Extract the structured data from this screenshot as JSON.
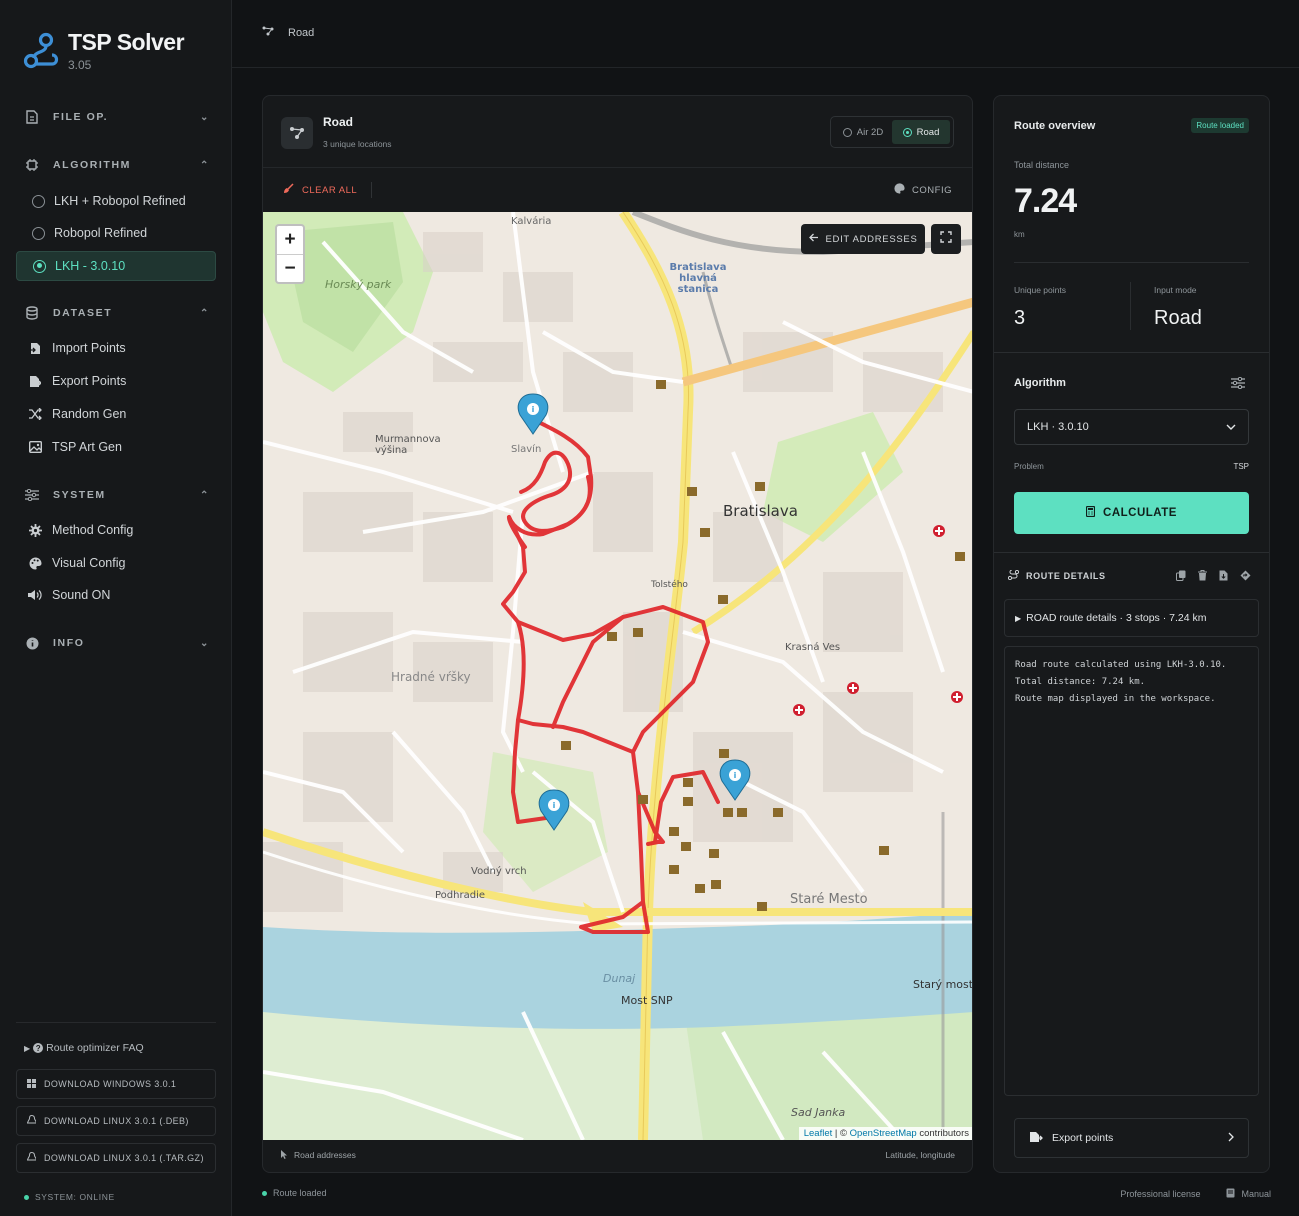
{
  "app": {
    "title": "TSP Solver",
    "version": "3.05"
  },
  "sidebar": {
    "file_op": "FILE OP.",
    "algorithm": "ALGORITHM",
    "algorithms": [
      {
        "label": "LKH + Robopol Refined"
      },
      {
        "label": "Robopol Refined"
      },
      {
        "label": "LKH - 3.0.10"
      }
    ],
    "dataset": "DATASET",
    "dataset_items": [
      {
        "label": "Import Points"
      },
      {
        "label": "Export Points"
      },
      {
        "label": "Random Gen"
      },
      {
        "label": "TSP Art Gen"
      }
    ],
    "system": "SYSTEM",
    "system_items": [
      {
        "label": "Method Config"
      },
      {
        "label": "Visual Config"
      },
      {
        "label": "Sound ON"
      }
    ],
    "info": "INFO",
    "faq": "Route optimizer FAQ",
    "downloads": [
      {
        "label": "DOWNLOAD WINDOWS 3.0.1"
      },
      {
        "label": "DOWNLOAD LINUX 3.0.1 (.DEB)"
      },
      {
        "label": "DOWNLOAD LINUX 3.0.1 (.TAR.GZ)"
      }
    ],
    "status": "SYSTEM: ONLINE"
  },
  "topbar": {
    "breadcrumb": "Road"
  },
  "map_card": {
    "title": "Road",
    "subtitle": "3 unique locations",
    "modes": [
      {
        "label": "Air 2D"
      },
      {
        "label": "Road"
      }
    ],
    "selected_mode": "Road",
    "clear_all": "CLEAR ALL",
    "config": "CONFIG",
    "edit_addresses": "EDIT ADDRESSES",
    "zoom_in": "+",
    "zoom_out": "−",
    "attribution_leaflet": "Leaflet",
    "attribution_sep": " | © ",
    "attribution_osm": "OpenStreetMap",
    "attribution_tail": " contributors",
    "footer_left": "Road addresses",
    "footer_right": "Latitude, longitude",
    "map_labels": {
      "bratislava": "Bratislava",
      "stare_mesto": "Staré Mesto",
      "dunaj": "Dunaj",
      "most_snp": "Most SNP",
      "stary_most": "Starý most",
      "hradne_vrsky": "Hradné vŕšky",
      "slavin": "Slavín",
      "kalvaria": "Kalvária",
      "horsky_park": "Horský park",
      "vodny_vrch": "Vodný vrch",
      "podhradie": "Podhradie",
      "petrzalka": "Sad Janka",
      "tolsteho": "Tolstého",
      "kraсna": "Krasná Ves",
      "murmannova": "Murmannova výšina",
      "hlavna": "Bratislava hlavná stanica"
    }
  },
  "overview": {
    "title": "Route overview",
    "badge": "Route loaded",
    "total_distance_label": "Total distance",
    "total_distance": "7.24",
    "unit": "km",
    "unique_points_label": "Unique points",
    "unique_points": "3",
    "input_mode_label": "Input mode",
    "input_mode": "Road",
    "algorithm_label": "Algorithm",
    "algorithm_value": "LKH · 3.0.10",
    "problem_label": "Problem",
    "problem_value": "TSP",
    "calculate": "CALCULATE",
    "route_details": "ROUTE DETAILS",
    "summary": "ROAD route details · 3 stops · 7.24 km",
    "log": [
      "Road route calculated using LKH-3.0.10.",
      "Total distance: 7.24 km.",
      "Route map displayed in the workspace."
    ],
    "export": "Export points"
  },
  "bottom": {
    "status": "Route loaded",
    "license": "Professional license",
    "manual": "Manual"
  },
  "colors": {
    "accent": "#5de0c1",
    "route": "#e0262a",
    "danger": "#ef6a5b",
    "marker": "#3aa2d6"
  }
}
